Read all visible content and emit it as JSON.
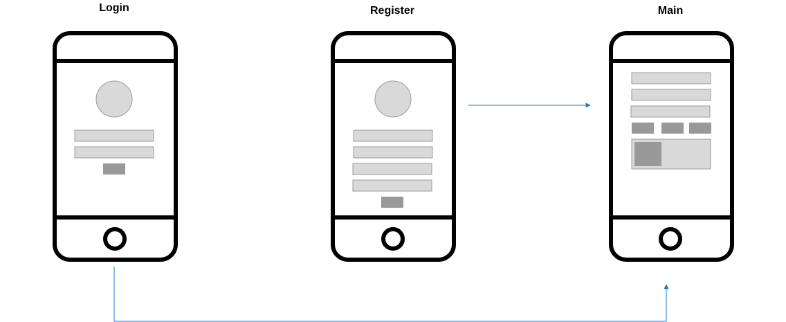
{
  "screens": [
    {
      "id": "login",
      "title": "Login"
    },
    {
      "id": "register",
      "title": "Register"
    },
    {
      "id": "main",
      "title": "Main"
    }
  ],
  "colors": {
    "frame": "#000000",
    "field_fill": "#d9d9d9",
    "field_stroke": "#9a9a9a",
    "button_fill": "#999999",
    "connector": "#1f76c8"
  },
  "edges": [
    {
      "from": "register",
      "to": "main"
    },
    {
      "from": "login",
      "to": "main"
    }
  ]
}
